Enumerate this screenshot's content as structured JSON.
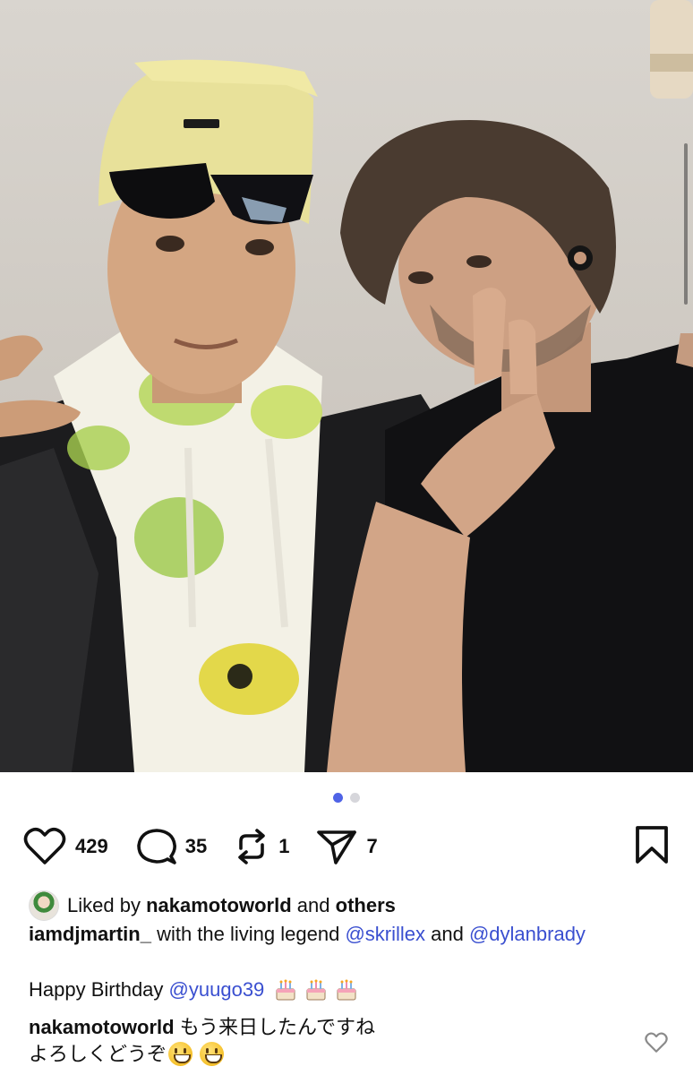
{
  "post": {
    "photo_alt": "",
    "carousel": {
      "total": 2,
      "active": 0
    },
    "actions": {
      "like": {
        "icon": "heart-icon",
        "count": "429"
      },
      "comment": {
        "icon": "comment-bubble-icon",
        "count": "35"
      },
      "repost": {
        "icon": "repost-icon",
        "count": "1"
      },
      "share": {
        "icon": "paper-plane-icon",
        "count": "7"
      },
      "save": {
        "icon": "bookmark-icon"
      }
    },
    "liked_by": {
      "prefix": "Liked by",
      "user": "nakamotoworld",
      "joiner": "and",
      "others": "others"
    },
    "caption": {
      "username": "iamdjmartin_",
      "text_1": "with the living legend",
      "mention_1": "@skrillex",
      "text_2": "and",
      "mention_2": "@dylanbrady"
    },
    "birthday": {
      "text": "Happy Birthday",
      "mention": "@yuugo39"
    },
    "comment": {
      "username": "nakamotoworld",
      "line_1": "もう来日したんですね",
      "line_2": "よろしくどうぞ"
    }
  },
  "colors": {
    "accent": "#4f63e6",
    "mention": "#3a4fd0",
    "text": "#111111"
  }
}
